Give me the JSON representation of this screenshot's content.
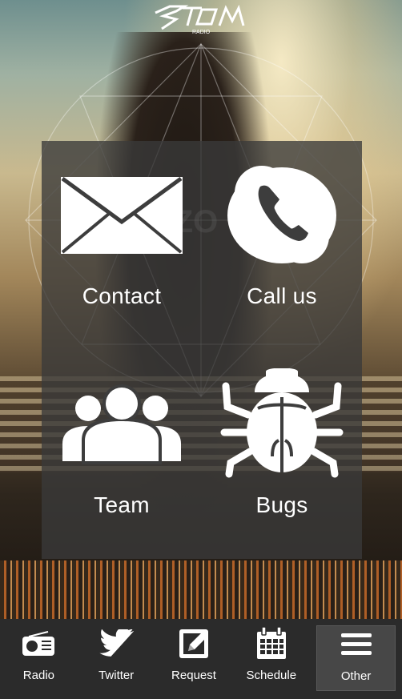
{
  "brand": {
    "logo_text": "STORM",
    "logo_sub": "RADIO"
  },
  "menu": {
    "tiles": [
      {
        "label": "Contact",
        "icon": "envelope-icon"
      },
      {
        "label": "Call us",
        "icon": "phone-icon"
      },
      {
        "label": "Team",
        "icon": "team-icon"
      },
      {
        "label": "Bugs",
        "icon": "bug-icon"
      }
    ]
  },
  "tabbar": {
    "tabs": [
      {
        "label": "Radio",
        "icon": "radio-icon"
      },
      {
        "label": "Twitter",
        "icon": "twitter-icon"
      },
      {
        "label": "Request",
        "icon": "edit-icon"
      },
      {
        "label": "Schedule",
        "icon": "calendar-icon"
      },
      {
        "label": "Other",
        "icon": "menu-icon"
      }
    ],
    "active": "Other"
  },
  "colors": {
    "overlay": "#3a3a3a",
    "tabbar": "#2b2b2b",
    "active_tab": "#474747",
    "icon": "#ffffff"
  }
}
